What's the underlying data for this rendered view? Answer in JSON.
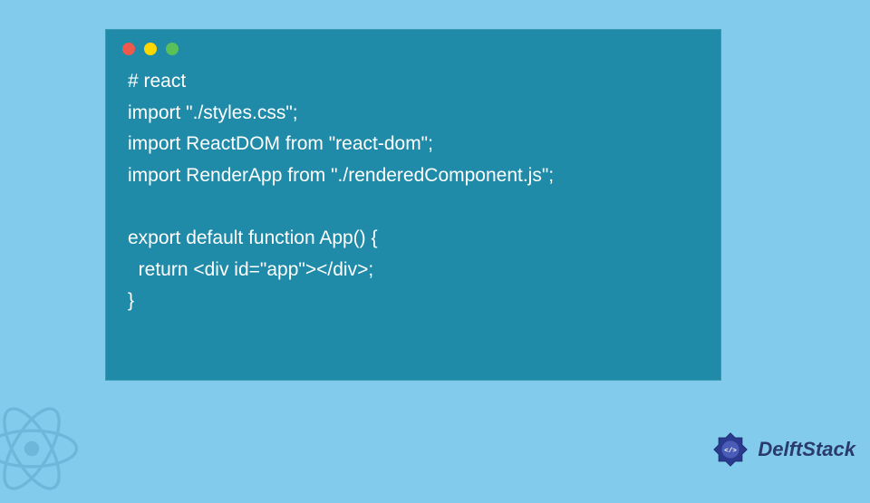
{
  "code": {
    "lines": [
      "# react",
      "import \"./styles.css\";",
      "",
      "import ReactDOM from \"react-dom\";",
      "",
      "import RenderApp from \"./renderedComponent.js\";",
      "",
      "",
      "export default function App() {",
      "  return <div id=\"app\"></div>;",
      "}"
    ]
  },
  "brand": {
    "name": "DelftStack"
  }
}
